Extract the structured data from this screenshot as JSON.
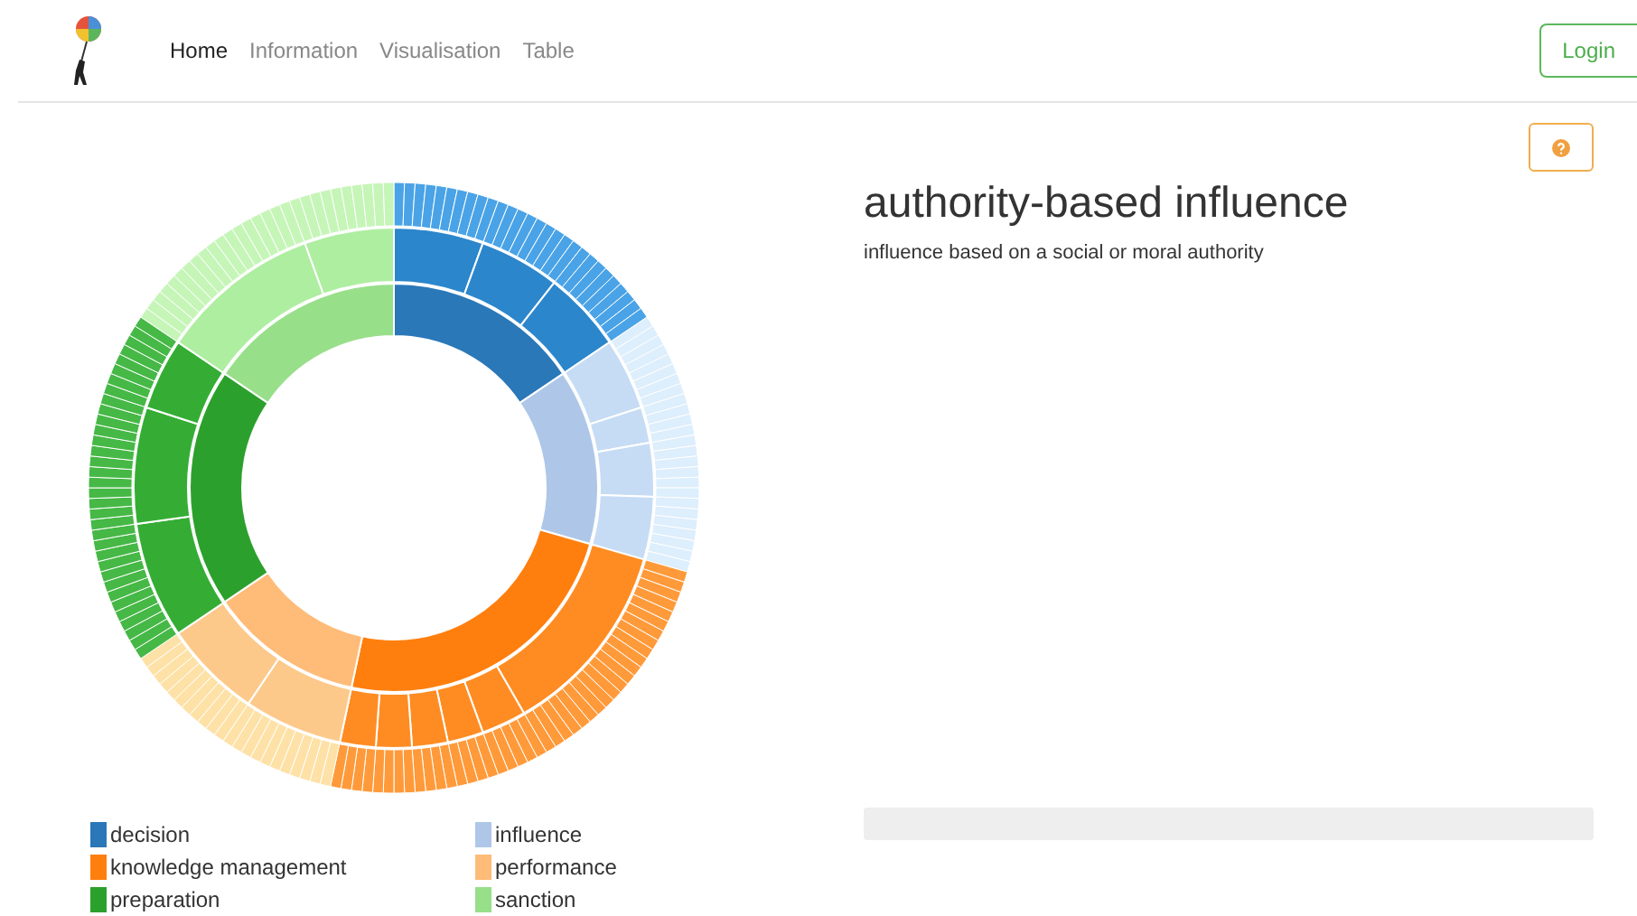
{
  "nav": {
    "items": [
      {
        "label": "Home",
        "selected": true
      },
      {
        "label": "Information",
        "selected": false
      },
      {
        "label": "Visualisation",
        "selected": false
      },
      {
        "label": "Table",
        "selected": false
      }
    ],
    "login": "Login"
  },
  "detail": {
    "title": "authority-based influence",
    "description": "influence based on a social or moral authority"
  },
  "legend": [
    {
      "label": "decision",
      "color": "#2a78b8"
    },
    {
      "label": "influence",
      "color": "#aec7e8"
    },
    {
      "label": "knowledge management",
      "color": "#ff7f0e"
    },
    {
      "label": "performance",
      "color": "#ffbb78"
    },
    {
      "label": "preparation",
      "color": "#2ca02c"
    },
    {
      "label": "sanction",
      "color": "#98df8a"
    }
  ]
}
